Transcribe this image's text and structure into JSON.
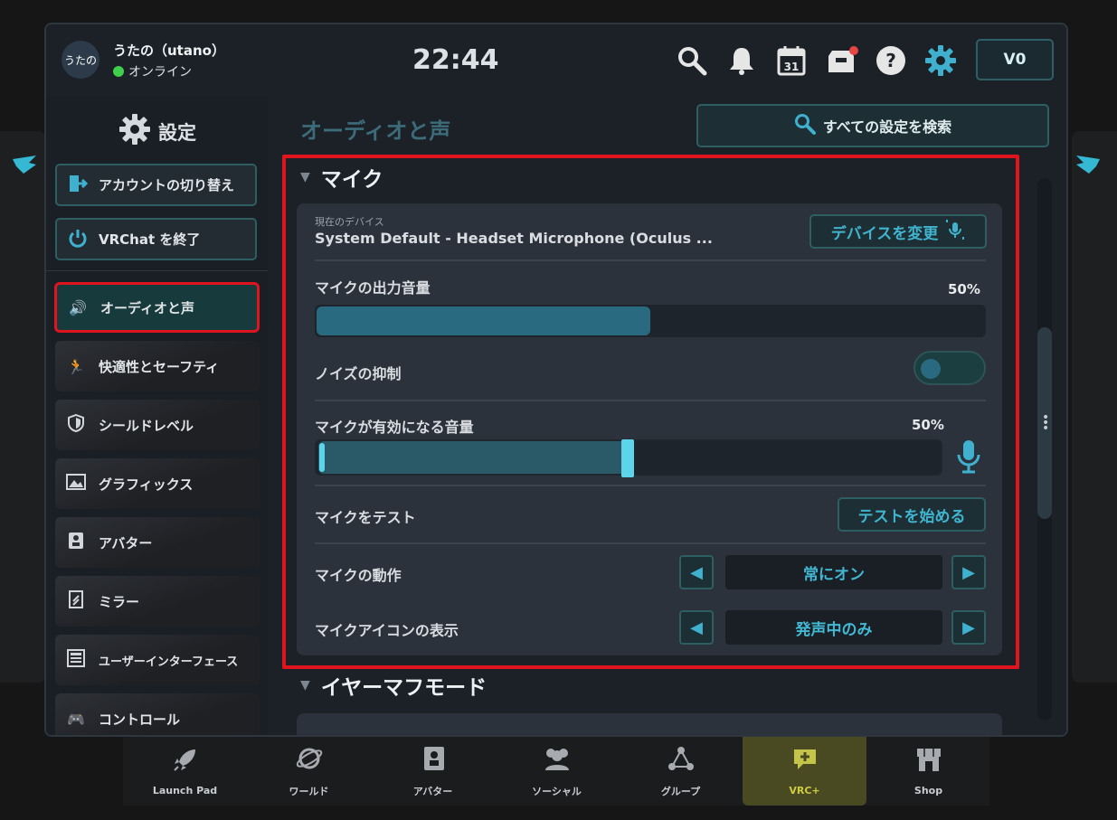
{
  "header": {
    "avatar_text": "うたの",
    "user_name": "うたの（utano）",
    "status": "オンライン",
    "clock": "22:44",
    "calendar_day": "31",
    "currency": "V0"
  },
  "sidebar": {
    "title": "設定",
    "switch_account": "アカウントの切り替え",
    "quit": "VRChat を終了",
    "items": [
      {
        "label": "オーディオと声"
      },
      {
        "label": "快適性とセーフティ"
      },
      {
        "label": "シールドレベル"
      },
      {
        "label": "グラフィックス"
      },
      {
        "label": "アバター"
      },
      {
        "label": "ミラー"
      },
      {
        "label": "ユーザーインターフェース"
      },
      {
        "label": "コントロール"
      }
    ]
  },
  "main": {
    "title": "オーディオと声",
    "search_label": "すべての設定を検索",
    "mic_section": "マイク",
    "current_device_label": "現在のデバイス",
    "current_device_value": "System Default - Headset Microphone (Oculus ...",
    "change_device": "デバイスを変更",
    "output_volume_label": "マイクの出力音量",
    "output_volume_value": "50%",
    "output_volume_level": 0.5,
    "noise_label": "ノイズの抑制",
    "noise_on": false,
    "activation_label": "マイクが有効になる音量",
    "activation_value": "50%",
    "activation_level": 0.5,
    "test_label": "マイクをテスト",
    "test_button": "テストを始める",
    "behavior_label": "マイクの動作",
    "behavior_value": "常にオン",
    "icon_display_label": "マイクアイコンの表示",
    "icon_display_value": "発声中のみ",
    "earmuff_section": "イヤーマフモード"
  },
  "bottom_nav": [
    {
      "label": "Launch Pad"
    },
    {
      "label": "ワールド"
    },
    {
      "label": "アバター"
    },
    {
      "label": "ソーシャル"
    },
    {
      "label": "グループ"
    },
    {
      "label": "VRC+"
    },
    {
      "label": "Shop"
    }
  ],
  "colors": {
    "accent": "#40b4cf",
    "highlight": "#e0141e",
    "online": "#3fcf4a"
  }
}
